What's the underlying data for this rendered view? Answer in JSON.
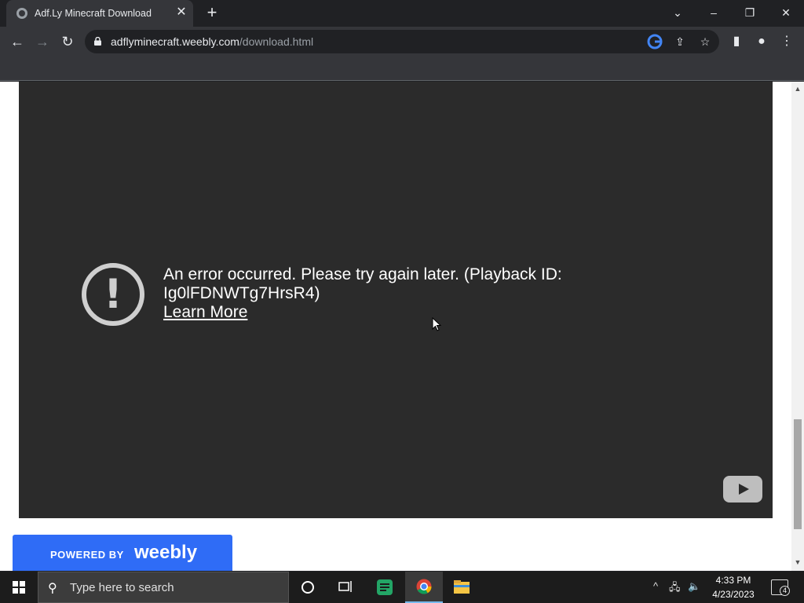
{
  "browser": {
    "tab_title": "Adf.Ly Minecraft Download",
    "url_domain": "adflyminecraft.weebly.com",
    "url_path": "/download.html"
  },
  "video": {
    "error_message": "An error occurred. Please try again later. (Playback ID: Ig0lFDNWTg7HrsR4)",
    "learn_more": "Learn More"
  },
  "footer": {
    "powered_by": "POWERED BY",
    "brand": "weebly"
  },
  "taskbar": {
    "search_placeholder": "Type here to search",
    "time": "4:33 PM",
    "date": "4/23/2023",
    "notification_count": "4"
  },
  "colors": {
    "video_bg": "#2b2b2b",
    "weebly_blue": "#2f6cf6"
  }
}
